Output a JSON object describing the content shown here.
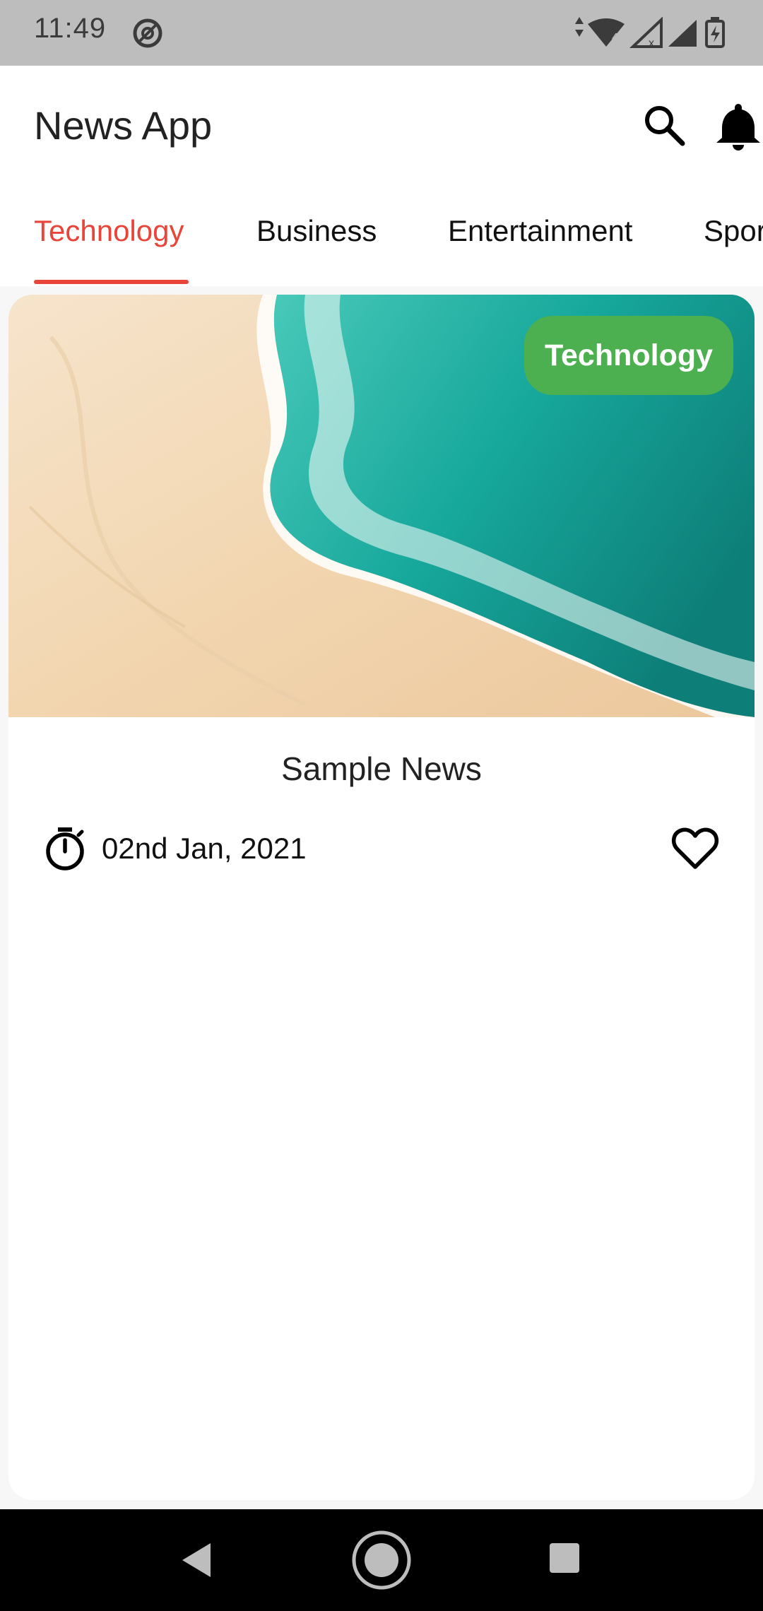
{
  "status_bar": {
    "time": "11:49"
  },
  "app_bar": {
    "title": "News App"
  },
  "tabs": [
    {
      "label": "Technology",
      "active": true
    },
    {
      "label": "Business",
      "active": false
    },
    {
      "label": "Entertainment",
      "active": false
    },
    {
      "label": "Spor",
      "active": false
    }
  ],
  "card": {
    "category": "Technology",
    "title": "Sample News",
    "date": "02nd Jan, 2021"
  },
  "colors": {
    "accent": "#e8443a",
    "chip": "#4caf50",
    "status_bar": "#bdbdbd"
  },
  "icons": {
    "status": [
      "data-saver-icon",
      "wifi-icon",
      "signal-icon",
      "battery-icon"
    ],
    "app_bar": [
      "search-icon",
      "bell-icon"
    ],
    "card": [
      "timer-icon",
      "heart-icon"
    ],
    "nav": [
      "back-icon",
      "home-icon",
      "recents-icon"
    ]
  }
}
